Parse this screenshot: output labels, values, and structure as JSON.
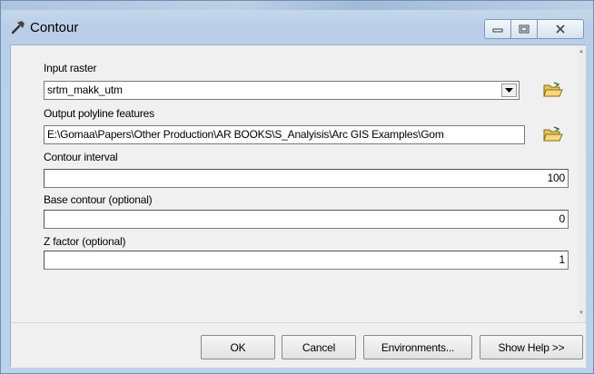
{
  "window": {
    "title": "Contour"
  },
  "form": {
    "input_raster": {
      "label": "Input raster",
      "value": "srtm_makk_utm"
    },
    "output_polyline": {
      "label": "Output polyline features",
      "value": "E:\\Gomaa\\Papers\\Other Production\\AR BOOKS\\S_Analyisis\\Arc GIS Examples\\Gom"
    },
    "contour_interval": {
      "label": "Contour interval",
      "value": "100"
    },
    "base_contour": {
      "label": "Base contour (optional)",
      "value": "0"
    },
    "z_factor": {
      "label": "Z factor (optional)",
      "value": "1"
    }
  },
  "buttons": {
    "ok": "OK",
    "cancel": "Cancel",
    "environments": "Environments...",
    "show_help": "Show Help >>"
  },
  "icons": {
    "title": "hammer-icon",
    "browse": "open-folder-icon",
    "dropdown": "chevron-down-icon"
  },
  "colors": {
    "title_bar": "#c9dbee",
    "dialog_bg": "#f0f0f0",
    "field_bg": "#ffffff"
  }
}
